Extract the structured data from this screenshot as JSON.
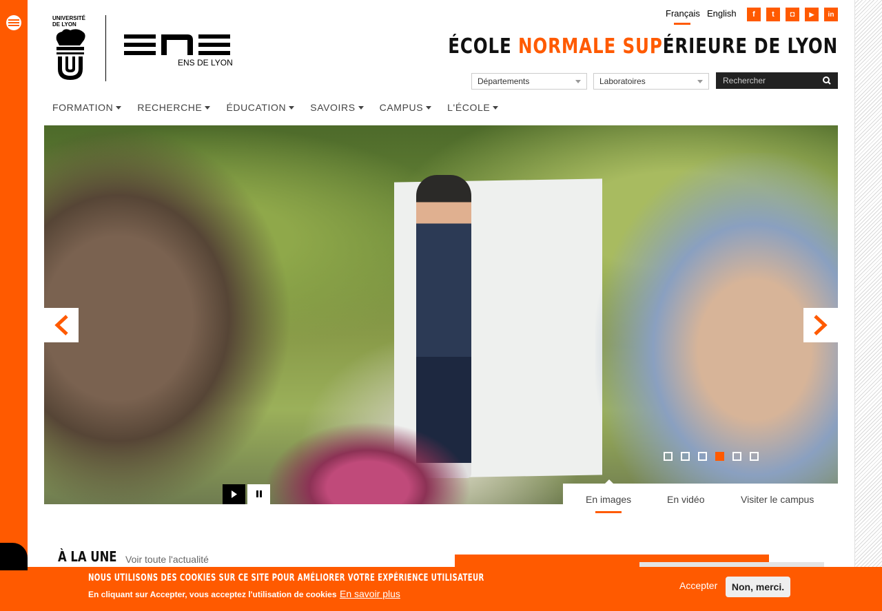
{
  "header": {
    "logo_udl_text": "UNIVERSITÉ DE LYON",
    "logo_ens_sub": "ENS DE LYON",
    "languages": [
      {
        "label": "Français",
        "active": true
      },
      {
        "label": "English",
        "active": false
      }
    ],
    "social": [
      {
        "name": "facebook",
        "glyph": "f"
      },
      {
        "name": "twitter",
        "glyph": "t"
      },
      {
        "name": "instagram",
        "glyph": "◘"
      },
      {
        "name": "youtube",
        "glyph": "▶"
      },
      {
        "name": "linkedin",
        "glyph": "in"
      }
    ],
    "title_part1": "ÉCOLE ",
    "title_highlight": "NORMALE SUP",
    "title_part2": "ÉRIEURE DE LYON",
    "select_departements": "Départements",
    "select_laboratoires": "Laboratoires",
    "search_placeholder": "Rechercher"
  },
  "nav": {
    "items": [
      {
        "label": "FORMATION"
      },
      {
        "label": "RECHERCHE"
      },
      {
        "label": "ÉDUCATION"
      },
      {
        "label": "SAVOIRS"
      },
      {
        "label": "CAMPUS"
      },
      {
        "label": "L'ÉCOLE"
      }
    ]
  },
  "hero": {
    "slide_count": 6,
    "active_slide": 4,
    "tabs": [
      {
        "label": "En images",
        "active": true
      },
      {
        "label": "En vidéo",
        "active": false
      },
      {
        "label": "Visiter le campus",
        "active": false
      }
    ]
  },
  "news": {
    "heading": "À LA UNE",
    "link": "Voir toute l'actualité"
  },
  "cookie": {
    "title": "NOUS UTILISONS DES COOKIES SUR CE SITE POUR AMÉLIORER VOTRE EXPÉRIENCE UTILISATEUR",
    "text": "En cliquant sur Accepter, vous acceptez l'utilisation de cookies",
    "more": "En savoir plus",
    "accept": "Accepter",
    "decline": "Non, merci."
  },
  "colors": {
    "accent": "#ff5a00",
    "dark": "#222222"
  }
}
